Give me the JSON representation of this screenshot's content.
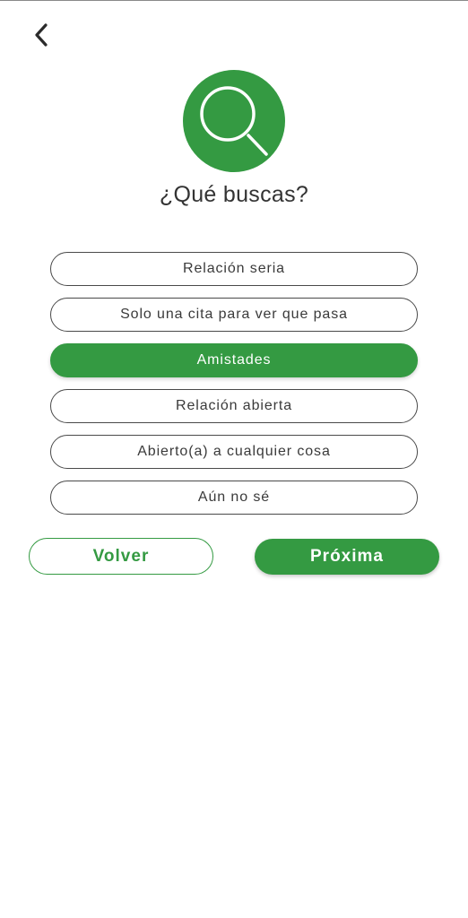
{
  "header": {
    "back_icon": "chevron-left-icon"
  },
  "hero": {
    "icon": "magnifier-icon",
    "accent_color": "#349a42"
  },
  "page": {
    "title": "¿Qué buscas?"
  },
  "options": [
    {
      "label": "Relación seria",
      "selected": false
    },
    {
      "label": "Solo una cita para ver que pasa",
      "selected": false
    },
    {
      "label": "Amistades",
      "selected": true
    },
    {
      "label": "Relación abierta",
      "selected": false
    },
    {
      "label": "Abierto(a) a cualquier cosa",
      "selected": false
    },
    {
      "label": "Aún no sé",
      "selected": false
    }
  ],
  "actions": {
    "back_label": "Volver",
    "next_label": "Próxima"
  }
}
